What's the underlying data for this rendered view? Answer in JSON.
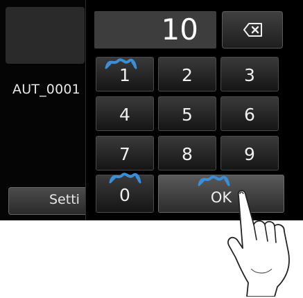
{
  "left_panel": {
    "file_name": "AUT_0001",
    "settings_label": "Setti"
  },
  "keypad": {
    "display_value": "10",
    "backspace_icon": "backspace-icon",
    "keys": [
      "1",
      "2",
      "3",
      "4",
      "5",
      "6",
      "7",
      "8",
      "9",
      "0"
    ],
    "ok_label": "OK"
  },
  "colors": {
    "screen_bg": "#050505",
    "key_bg": "#2a2a2a",
    "tap_mark": "#3b8fd8",
    "text": "#f0f0f0"
  }
}
